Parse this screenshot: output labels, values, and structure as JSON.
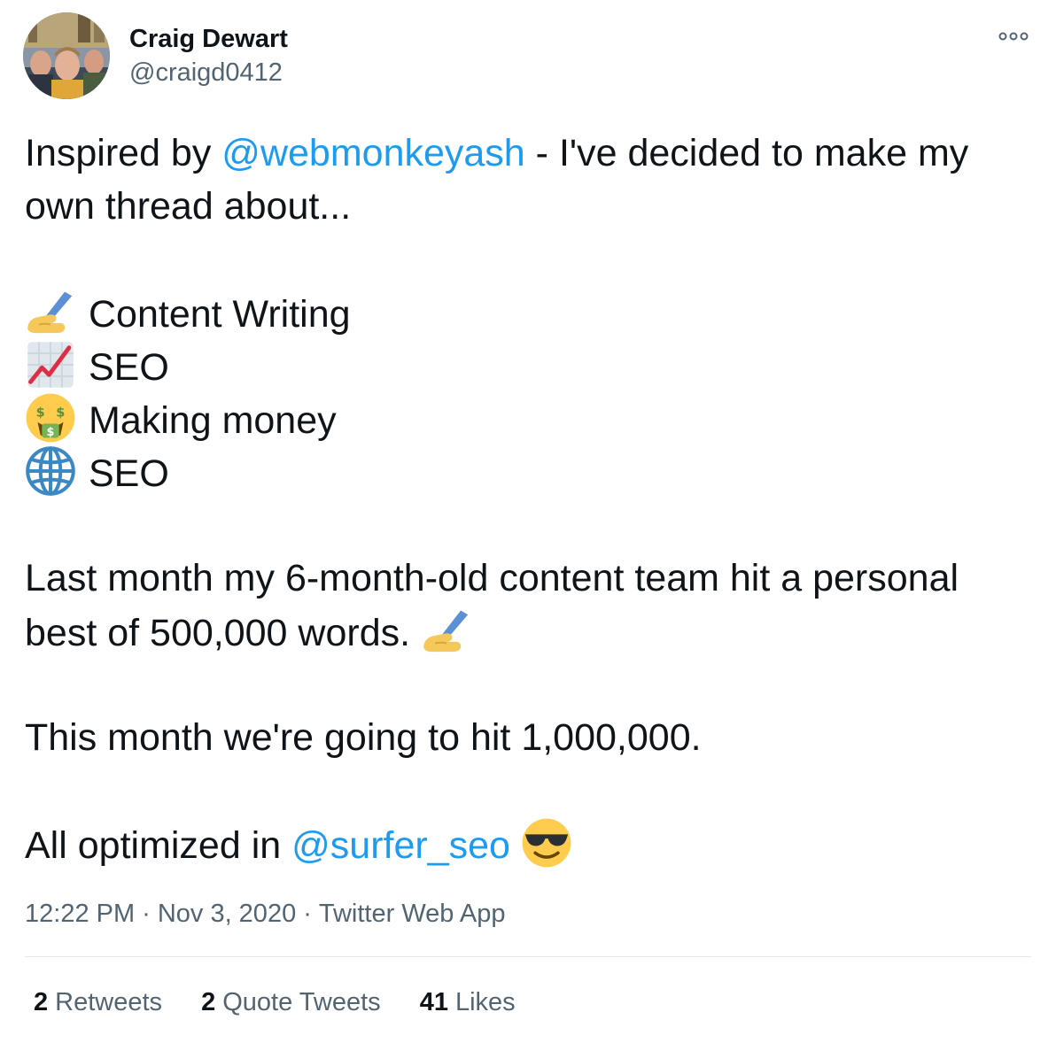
{
  "author": {
    "display_name": "Craig Dewart",
    "handle": "@craigd0412"
  },
  "tweet": {
    "line1_prefix": "Inspired by ",
    "line1_mention": "@webmonkeyash",
    "line1_suffix": " - I've decided to make my",
    "line2": "own thread about...",
    "topics": [
      {
        "icon": "writing-hand-icon",
        "label": "Content Writing"
      },
      {
        "icon": "chart-increasing-icon",
        "label": "SEO"
      },
      {
        "icon": "money-mouth-face-icon",
        "label": "Making money"
      },
      {
        "icon": "globe-meridians-icon",
        "label": "SEO"
      }
    ],
    "para2_line1": "Last month my 6-month-old content team hit a personal",
    "para2_line2": "best of 500,000 words.",
    "para3": "This month we're going to hit 1,000,000.",
    "para4_prefix": "All optimized in ",
    "para4_mention": "@surfer_seo",
    "para4_emoji": "smiling-face-with-sunglasses-icon"
  },
  "meta": {
    "time": "12:22 PM",
    "separator": "·",
    "date": "Nov 3, 2020",
    "source": "Twitter Web App"
  },
  "stats": {
    "retweets_count": "2",
    "retweets_label": "Retweets",
    "quotes_count": "2",
    "quotes_label": "Quote Tweets",
    "likes_count": "41",
    "likes_label": "Likes"
  },
  "colors": {
    "link": "#1d9bf0",
    "text": "#0f1419",
    "secondary": "#536471",
    "divider": "#e1e8ed"
  }
}
